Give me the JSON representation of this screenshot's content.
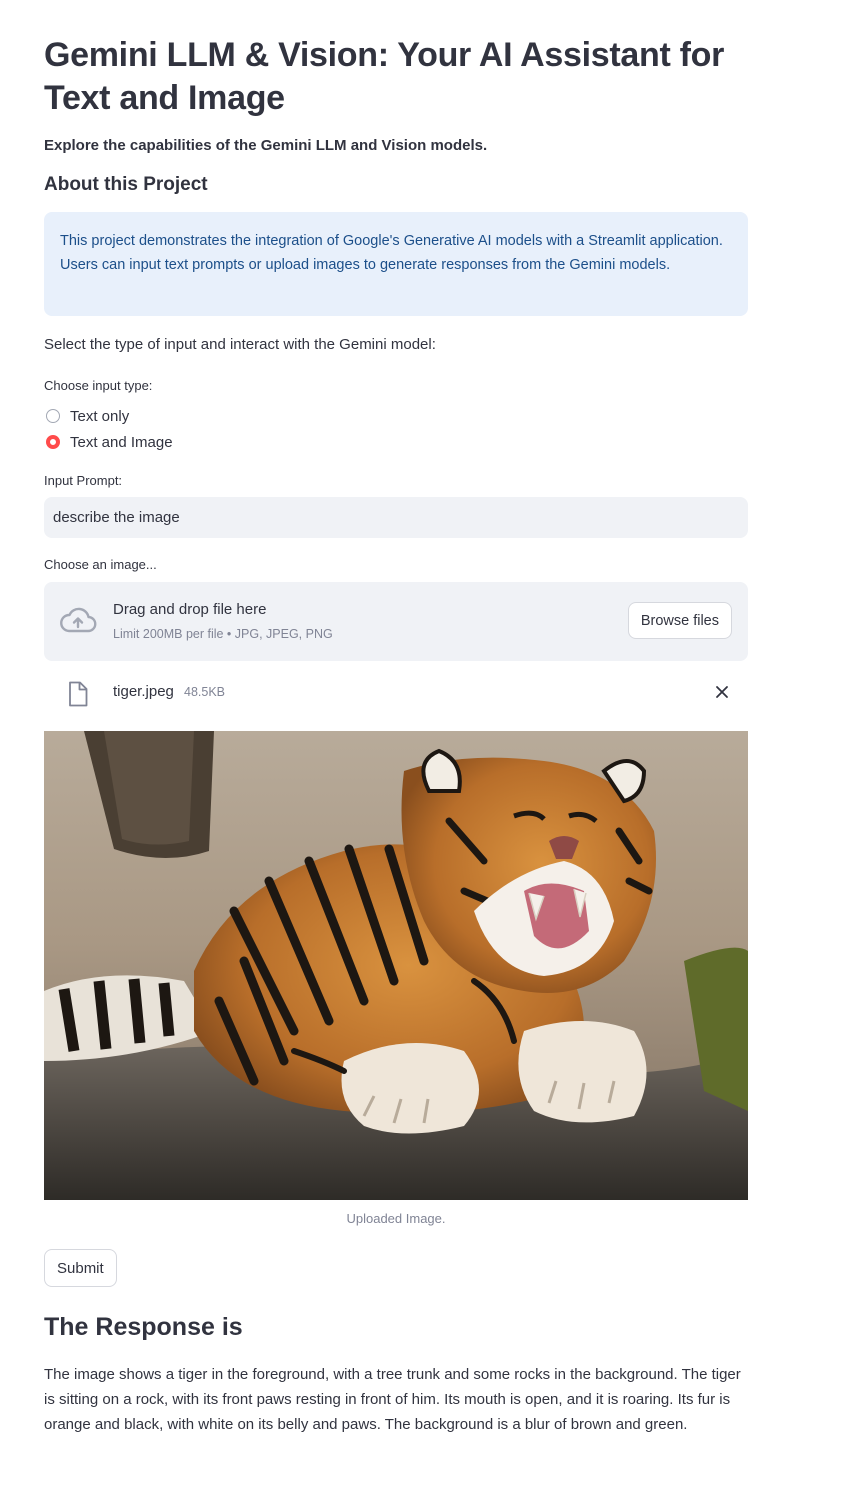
{
  "header": {
    "title": "Gemini LLM & Vision: Your AI Assistant for Text and Image",
    "subtitle": "Explore the capabilities of the Gemini LLM and Vision models."
  },
  "about": {
    "heading": "About this Project",
    "info": "This project demonstrates the integration of Google's Generative AI models with a Streamlit application. Users can input text prompts or upload images to generate responses from the Gemini models."
  },
  "instruction": "Select the type of input and interact with the Gemini model:",
  "input_type": {
    "label": "Choose input type:",
    "options": [
      "Text only",
      "Text and Image"
    ],
    "selected": "Text and Image"
  },
  "prompt": {
    "label": "Input Prompt:",
    "value": "describe the image"
  },
  "uploader": {
    "label": "Choose an image...",
    "drop_title": "Drag and drop file here",
    "limit": "Limit 200MB per file • JPG, JPEG, PNG",
    "browse_label": "Browse files",
    "file_name": "tiger.jpeg",
    "file_size": "48.5KB"
  },
  "image": {
    "caption": "Uploaded Image."
  },
  "submit_label": "Submit",
  "response": {
    "heading": "The Response is",
    "text": "The image shows a tiger in the foreground, with a tree trunk and some rocks in the background. The tiger is sitting on a rock, with its front paws resting in front of him. Its mouth is open, and it is roaring. Its fur is orange and black, with white on its belly and paws. The background is a blur of brown and green."
  },
  "colors": {
    "accent": "#ff4b4b",
    "info_bg": "#e8f0fb",
    "info_text": "#1c4f8a",
    "input_bg": "#f0f2f6"
  }
}
